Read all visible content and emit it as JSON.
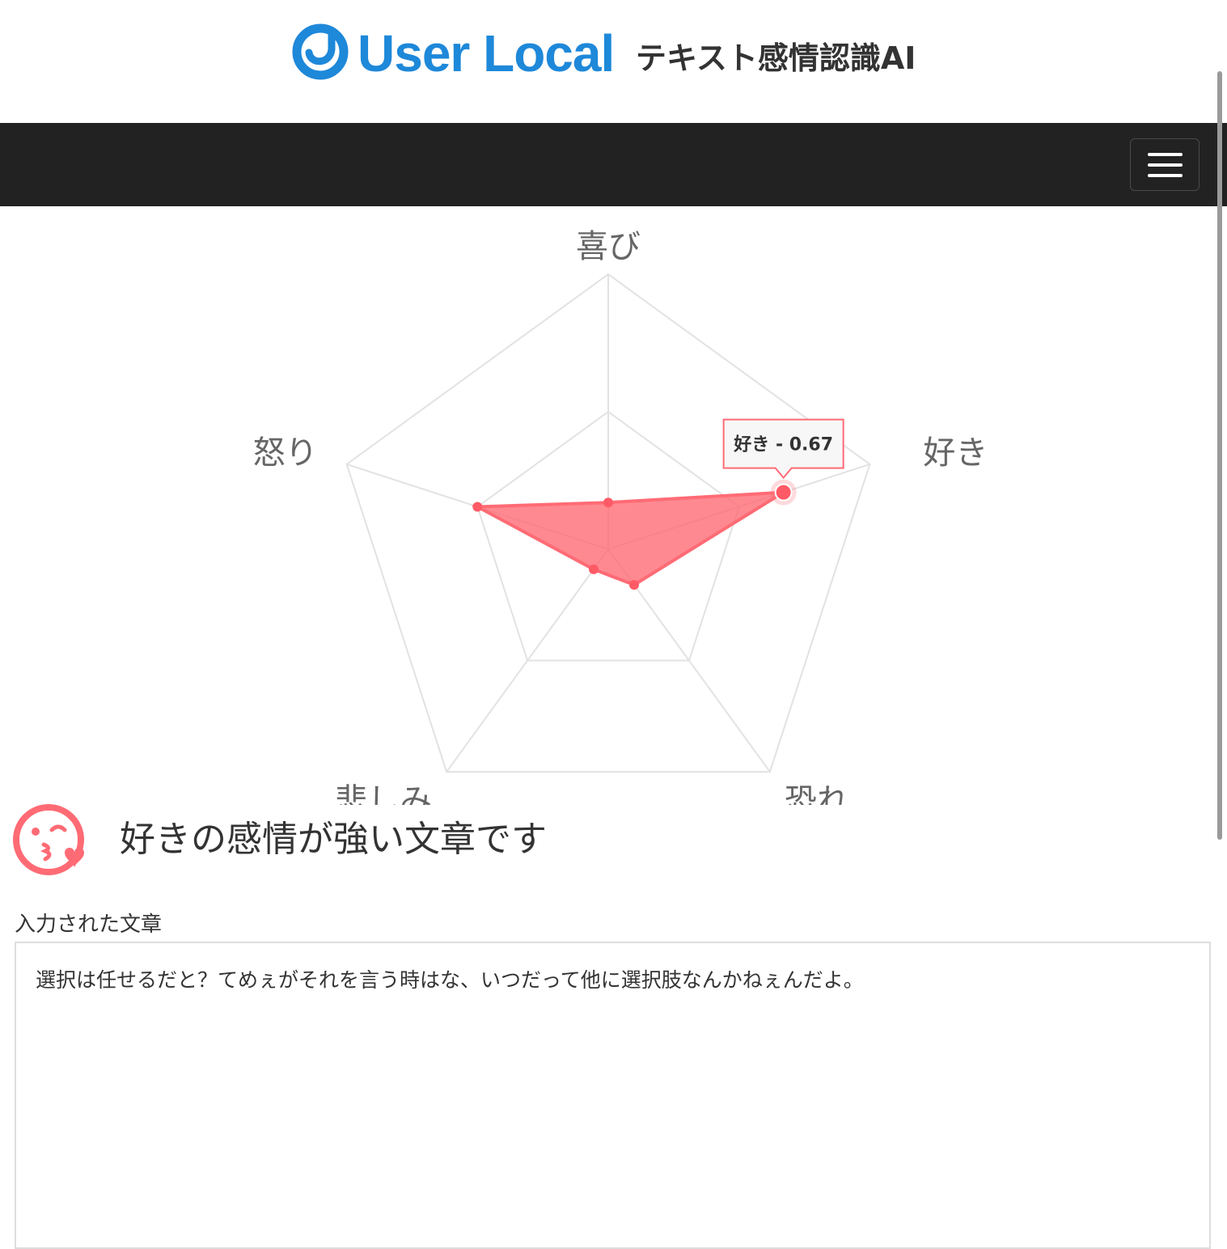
{
  "header": {
    "brand": "User Local",
    "product": "テキスト感情認識AI"
  },
  "nav": {
    "menu_icon": "hamburger-icon"
  },
  "chart_data": {
    "type": "radar",
    "axes": [
      "喜び",
      "好き",
      "恐れ",
      "悲しみ",
      "怒り"
    ],
    "values": [
      0.17,
      0.67,
      0.16,
      0.09,
      0.5
    ],
    "range": [
      0,
      1
    ],
    "rings": [
      0.5,
      1.0
    ],
    "series_color": "#ff6b75",
    "tooltip": {
      "axis": "好き",
      "label": "好き - 0.67"
    }
  },
  "result": {
    "icon": "kiss-face-icon",
    "text": "好きの感情が強い文章です"
  },
  "input": {
    "label": "入力された文章",
    "text": "選択は任せるだと？てめぇがそれを言う時はな、いつだって他に選択肢なんかねぇんだよ。"
  },
  "colors": {
    "brand": "#1e88d9",
    "navbar": "#222222",
    "accent": "#ff6b75"
  }
}
